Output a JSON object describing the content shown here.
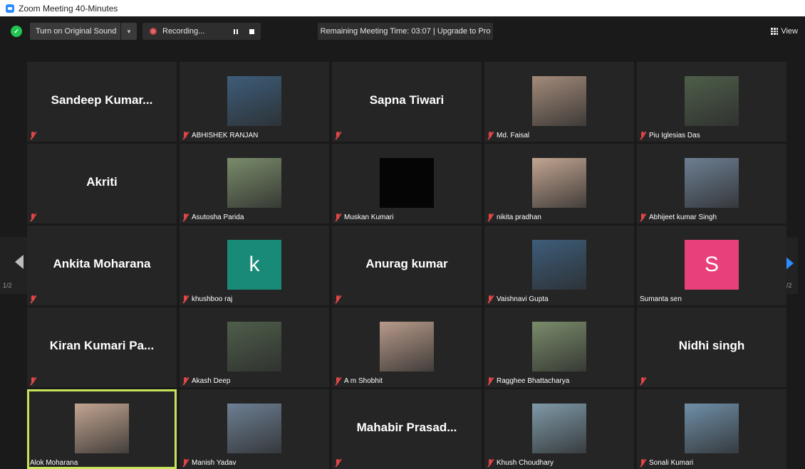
{
  "window": {
    "title": "Zoom Meeting 40-Minutes"
  },
  "toolbar": {
    "original_sound_label": "Turn on Original Sound",
    "recording_label": "Recording...",
    "remaining_time": "Remaining Meeting Time: 03:07 | Upgrade to Pro",
    "view_label": "View"
  },
  "pagination": {
    "left": "1/2",
    "right": "1/2"
  },
  "colors": {
    "active_border": "#c7e35a",
    "next_arrow": "#2d8cff",
    "muted": "#e04646"
  },
  "participants": [
    {
      "label": "Sandeep Kumar...",
      "muted": true,
      "kind": "name"
    },
    {
      "label": "ABHISHEK RANJAN",
      "muted": true,
      "kind": "photo"
    },
    {
      "label": "Sapna Tiwari",
      "muted": true,
      "kind": "name"
    },
    {
      "label": "Md. Faisal",
      "muted": true,
      "kind": "photo"
    },
    {
      "label": "Piu Iglesias Das",
      "muted": true,
      "kind": "photo"
    },
    {
      "label": "Akriti",
      "muted": true,
      "kind": "name"
    },
    {
      "label": "Asutosha Parida",
      "muted": true,
      "kind": "photo"
    },
    {
      "label": "Muskan Kumari",
      "muted": true,
      "kind": "photo-black"
    },
    {
      "label": "nikita pradhan",
      "muted": true,
      "kind": "photo"
    },
    {
      "label": "Abhijeet kumar Singh",
      "muted": true,
      "kind": "photo"
    },
    {
      "label": "Ankita Moharana",
      "muted": true,
      "kind": "name"
    },
    {
      "label": "khushboo raj",
      "muted": true,
      "kind": "letter",
      "letter": "k",
      "bg": "#1a8a78"
    },
    {
      "label": "Anurag kumar",
      "muted": true,
      "kind": "name"
    },
    {
      "label": "Vaishnavi Gupta",
      "muted": true,
      "kind": "photo"
    },
    {
      "label": "Sumanta sen",
      "muted": false,
      "kind": "letter",
      "letter": "S",
      "bg": "#e8407a"
    },
    {
      "label": "Kiran Kumari Pa...",
      "muted": true,
      "kind": "name"
    },
    {
      "label": "Akash Deep",
      "muted": true,
      "kind": "photo"
    },
    {
      "label": "A m Shobhit",
      "muted": true,
      "kind": "photo"
    },
    {
      "label": "Ragghee Bhattacharya",
      "muted": true,
      "kind": "photo"
    },
    {
      "label": "Nidhi singh",
      "muted": true,
      "kind": "name"
    },
    {
      "label": "Alok Moharana",
      "muted": false,
      "kind": "photo",
      "active": true
    },
    {
      "label": "Manish Yadav",
      "muted": true,
      "kind": "photo"
    },
    {
      "label": "Mahabir Prasad...",
      "muted": true,
      "kind": "name"
    },
    {
      "label": "Khush Choudhary",
      "muted": true,
      "kind": "photo"
    },
    {
      "label": "Sonali Kumari",
      "muted": true,
      "kind": "photo"
    }
  ]
}
